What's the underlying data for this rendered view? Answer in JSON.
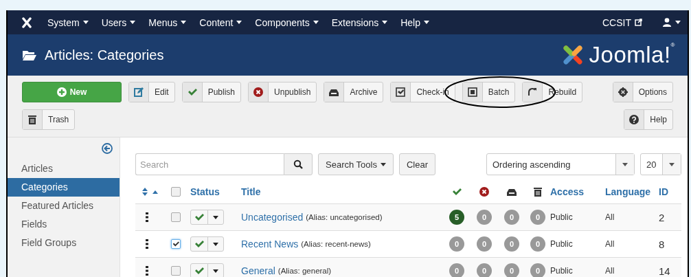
{
  "navbar": {
    "menus": [
      {
        "label": "System"
      },
      {
        "label": "Users"
      },
      {
        "label": "Menus"
      },
      {
        "label": "Content"
      },
      {
        "label": "Components"
      },
      {
        "label": "Extensions"
      },
      {
        "label": "Help"
      }
    ],
    "site_link": "CCSIT"
  },
  "header": {
    "title": "Articles: Categories",
    "logo_text": "Joomla!$^{®}$"
  },
  "toolbar": {
    "main": [
      {
        "kind": "new",
        "label": "New"
      },
      {
        "kind": "edit",
        "label": "Edit"
      },
      {
        "kind": "publish",
        "label": "Publish"
      },
      {
        "kind": "unpublish",
        "label": "Unpublish"
      },
      {
        "kind": "archive",
        "label": "Archive"
      },
      {
        "kind": "checkin",
        "label": "Check-in"
      },
      {
        "kind": "batch",
        "label": "Batch"
      },
      {
        "kind": "rebuild",
        "label": "Rebuild"
      },
      {
        "kind": "trash",
        "label": "Trash"
      }
    ],
    "side": [
      {
        "kind": "options",
        "label": "Options"
      },
      {
        "kind": "help",
        "label": "Help"
      }
    ]
  },
  "sidebar": {
    "items": [
      {
        "label": "Articles",
        "selected": false
      },
      {
        "label": "Categories",
        "selected": true
      },
      {
        "label": "Featured Articles",
        "selected": false
      },
      {
        "label": "Fields",
        "selected": false
      },
      {
        "label": "Field Groups",
        "selected": false
      }
    ]
  },
  "filters": {
    "search": {
      "placeholder": "Search"
    },
    "search_tools": "Search Tools",
    "clear": "Clear",
    "ordering": "Ordering ascending",
    "limit": "20"
  },
  "table": {
    "header": {
      "checked": false,
      "columns": [
        {
          "kind": "sort"
        },
        {
          "kind": "checkbox"
        },
        {
          "kind": "text",
          "label": "Status"
        },
        {
          "kind": "text",
          "label": "Title"
        },
        {
          "kind": "published"
        },
        {
          "kind": "unpublished"
        },
        {
          "kind": "archived"
        },
        {
          "kind": "trashed"
        },
        {
          "kind": "text",
          "label": "Access"
        },
        {
          "kind": "text",
          "label": "Language"
        },
        {
          "kind": "text",
          "label": "ID"
        }
      ]
    },
    "rows": [
      {
        "checked": false,
        "published": true,
        "title": "Uncategorised",
        "alias": "(Alias: uncategorised)",
        "counts": [
          {
            "value": "5",
            "highlighted": true
          },
          {
            "value": "0",
            "highlighted": false
          },
          {
            "value": "0",
            "highlighted": false
          },
          {
            "value": "0",
            "highlighted": false
          }
        ],
        "access": "Public",
        "language": "All",
        "id": "2"
      },
      {
        "checked": true,
        "published": true,
        "title": "Recent News",
        "alias": "(Alias: recent-news)",
        "counts": [
          {
            "value": "0",
            "highlighted": false
          },
          {
            "value": "0",
            "highlighted": false
          },
          {
            "value": "0",
            "highlighted": false
          },
          {
            "value": "0",
            "highlighted": false
          }
        ],
        "access": "Public",
        "language": "All",
        "id": "8"
      },
      {
        "checked": false,
        "published": true,
        "title": "General",
        "alias": "(Alias: general)",
        "counts": [
          {
            "value": "0",
            "highlighted": false
          },
          {
            "value": "0",
            "highlighted": false
          },
          {
            "value": "0",
            "highlighted": false
          },
          {
            "value": "0",
            "highlighted": false
          }
        ],
        "access": "Public",
        "language": "All",
        "id": "14"
      }
    ]
  }
}
